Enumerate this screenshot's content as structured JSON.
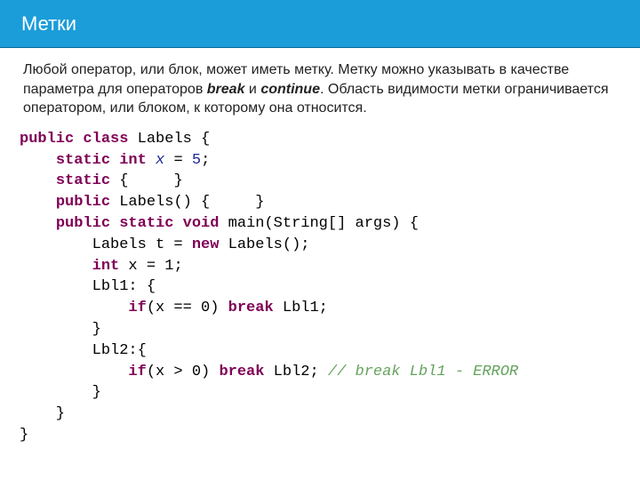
{
  "header": {
    "title": "Метки"
  },
  "description": {
    "part1": "Любой оператор, или блок, может иметь метку. Метку можно указывать в качестве параметра для операторов ",
    "kw1": "break",
    "mid": " и ",
    "kw2": "continue",
    "part2": ". Область видимости метки ограничивается оператором, или блоком, к которому она относится."
  },
  "code": {
    "l1a": "public",
    "l1b": "class",
    "l1c": " Labels {",
    "l2a": "static",
    "l2b": "int",
    "l2c": "x",
    "l2d": " = ",
    "l2e": "5",
    "l2f": ";",
    "l3a": "static",
    "l3b": " {     }",
    "l4a": "public",
    "l4b": " Labels() {     }",
    "l5a": "public",
    "l5b": "static",
    "l5c": "void",
    "l5d": " main(String[] args) {",
    "l6a": "        Labels t = ",
    "l6b": "new",
    "l6c": " Labels();",
    "l7a": "int",
    "l7b": " x = 1;",
    "l8": "        Lbl1: {",
    "l9a": "if",
    "l9b": "(x == 0) ",
    "l9c": "break",
    "l9d": " Lbl1;",
    "l10": "        }",
    "l11": "        Lbl2:{",
    "l12a": "if",
    "l12b": "(x > 0) ",
    "l12c": "break",
    "l12d": " Lbl2; ",
    "l12e": "// break Lbl1 - ERROR",
    "l13": "        }",
    "l14": "    }",
    "l15": "}"
  }
}
